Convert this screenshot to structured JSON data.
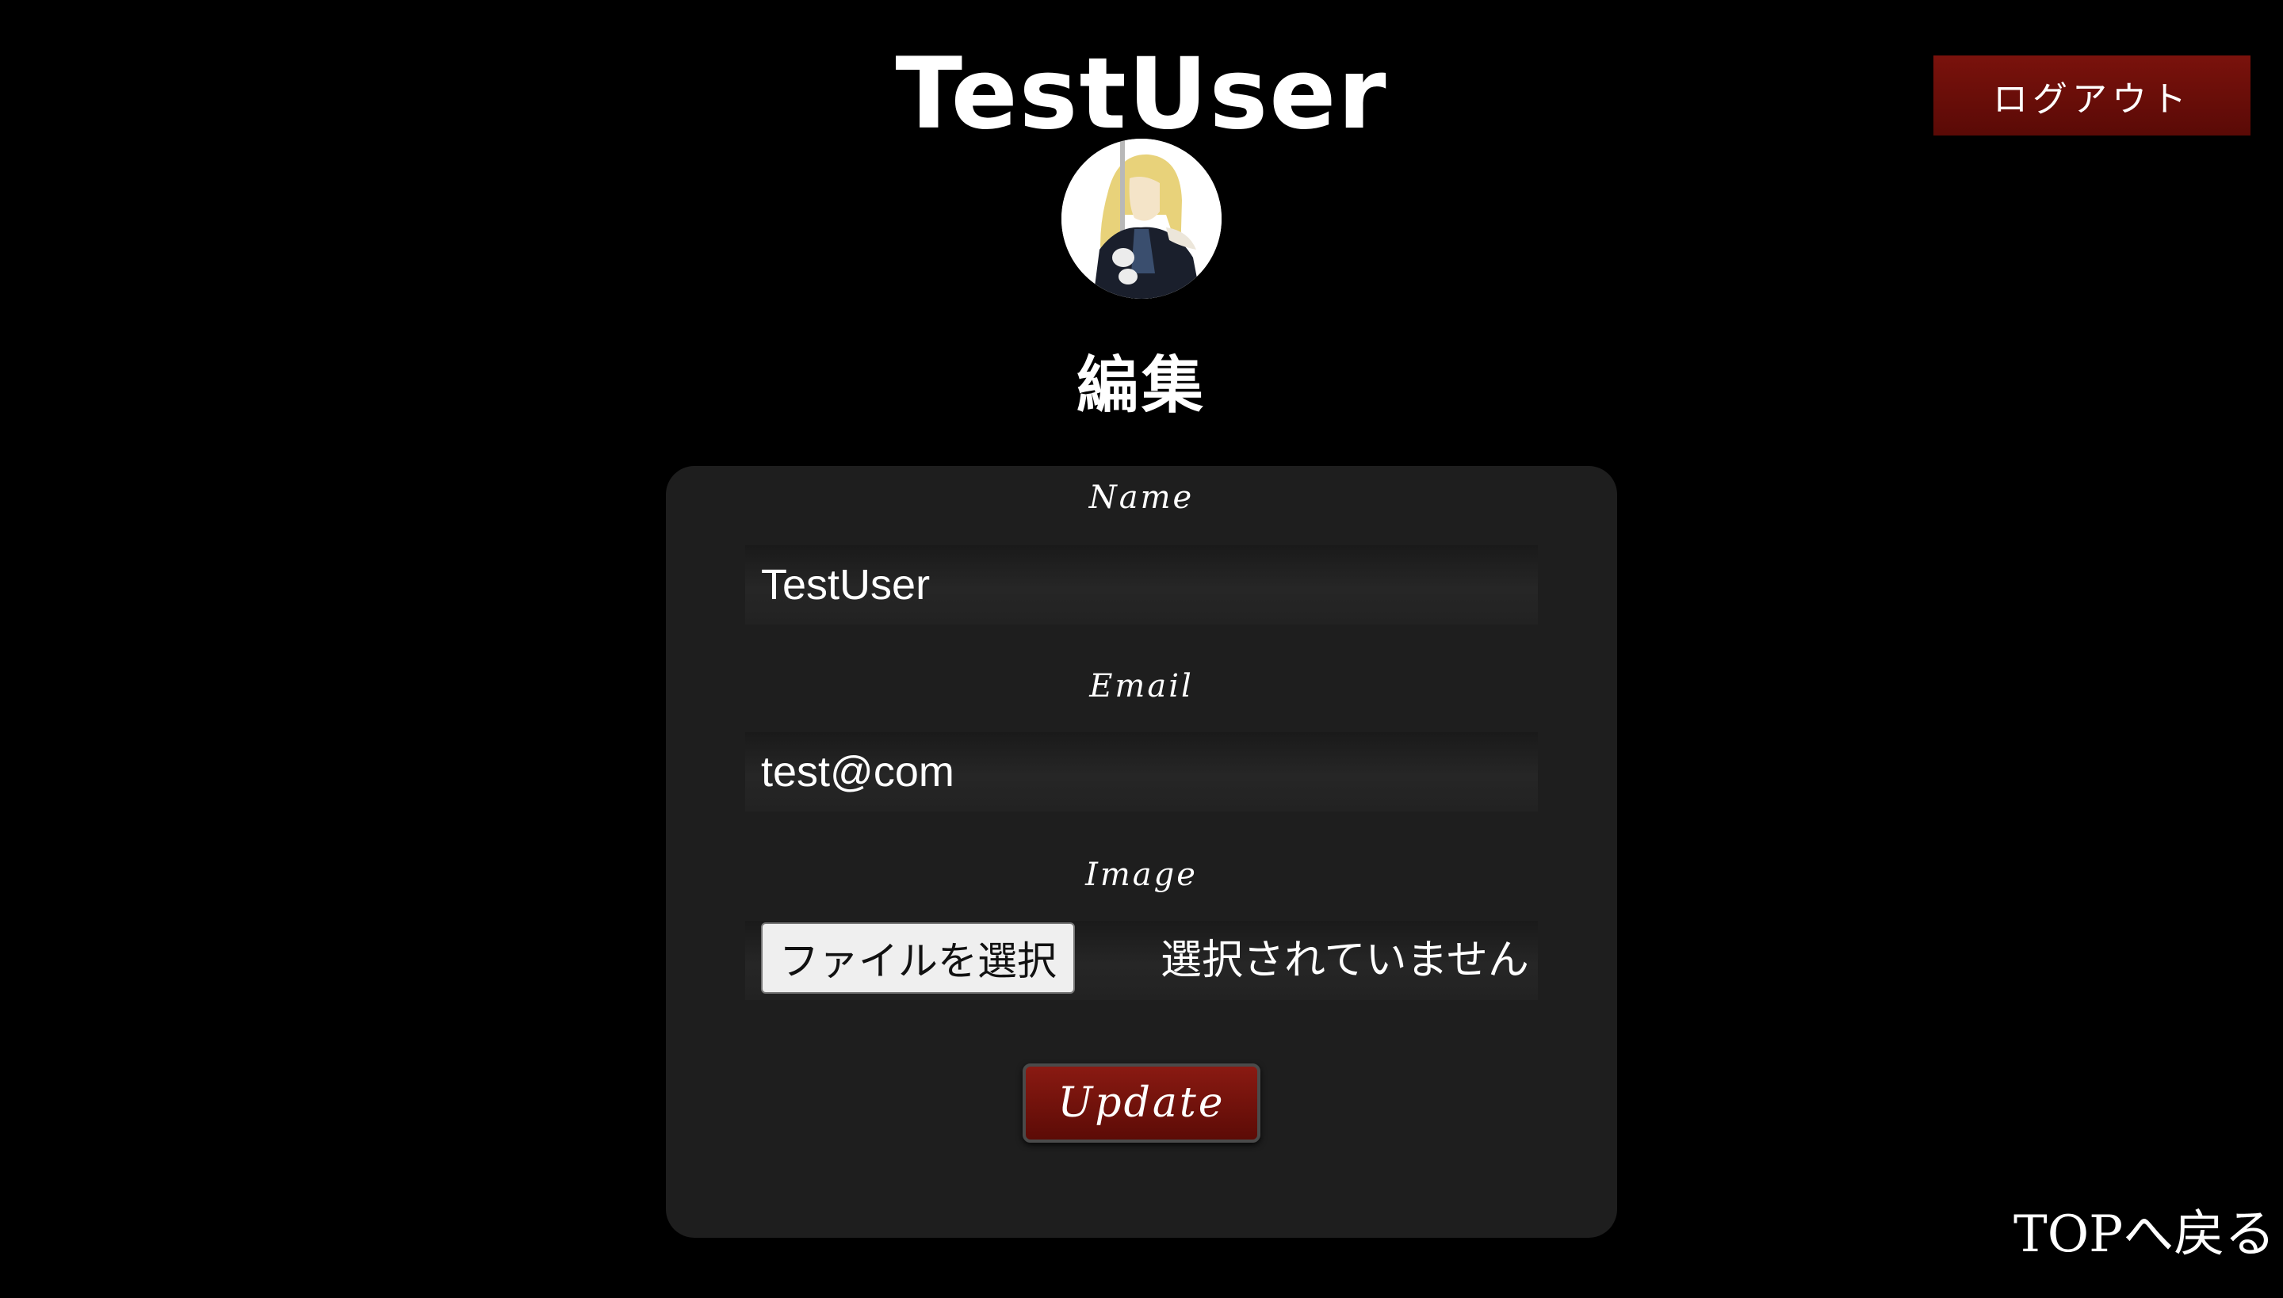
{
  "header": {
    "user_name": "TestUser",
    "logout_label": "ログアウト"
  },
  "page": {
    "heading": "編集"
  },
  "form": {
    "name_label": "Name",
    "name_value": "TestUser",
    "email_label": "Email",
    "email_value": "test@com",
    "image_label": "Image",
    "file_button_label": "ファイルを選択",
    "file_status": "選択されていません",
    "update_label": "Update"
  },
  "footer": {
    "top_link_label": "TOPへ戻る"
  },
  "colors": {
    "background": "#000000",
    "card": "#1e1e1e",
    "accent_red": "#7a120c"
  },
  "icons": {
    "avatar": "user-avatar-image"
  }
}
